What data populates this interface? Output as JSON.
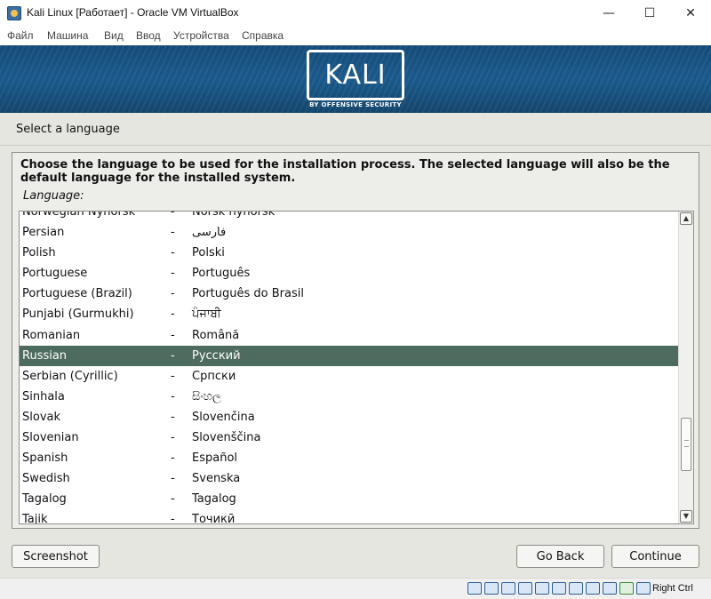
{
  "window": {
    "title": "Kali Linux [Работает] - Oracle VM VirtualBox",
    "minimize": "—",
    "maximize": "☐",
    "close": "✕"
  },
  "menubar": [
    "Файл",
    "Машина",
    "Вид",
    "Ввод",
    "Устройства",
    "Справка"
  ],
  "banner": {
    "logo": "KALI",
    "tagline": "BY OFFENSIVE SECURITY"
  },
  "page": {
    "heading": "Select a language",
    "instructions": "Choose the language to be used for the installation process. The selected language will also be the default language for the installed system.",
    "field_label": "Language:"
  },
  "languages": [
    {
      "english": "Norwegian Nynorsk",
      "native": "Norsk nynorsk"
    },
    {
      "english": "Persian",
      "native": "فارسی"
    },
    {
      "english": "Polish",
      "native": "Polski"
    },
    {
      "english": "Portuguese",
      "native": "Português"
    },
    {
      "english": "Portuguese (Brazil)",
      "native": "Português do Brasil"
    },
    {
      "english": "Punjabi (Gurmukhi)",
      "native": "ਪੰਜਾਬੀ"
    },
    {
      "english": "Romanian",
      "native": "Română"
    },
    {
      "english": "Russian",
      "native": "Русский"
    },
    {
      "english": "Serbian (Cyrillic)",
      "native": "Српски"
    },
    {
      "english": "Sinhala",
      "native": "සිංහල"
    },
    {
      "english": "Slovak",
      "native": "Slovenčina"
    },
    {
      "english": "Slovenian",
      "native": "Slovenščina"
    },
    {
      "english": "Spanish",
      "native": "Español"
    },
    {
      "english": "Swedish",
      "native": "Svenska"
    },
    {
      "english": "Tagalog",
      "native": "Tagalog"
    },
    {
      "english": "Tajik",
      "native": "Точикӣ"
    }
  ],
  "separator": "-",
  "selected_language": "Russian",
  "buttons": {
    "screenshot": "Screenshot",
    "go_back": "Go Back",
    "continue": "Continue"
  },
  "statusbar": {
    "host_key": "Right Ctrl"
  },
  "colors": {
    "banner": "#1c5c8f",
    "selection": "#4d6b5e",
    "installer_bg": "#e6e6e1"
  }
}
